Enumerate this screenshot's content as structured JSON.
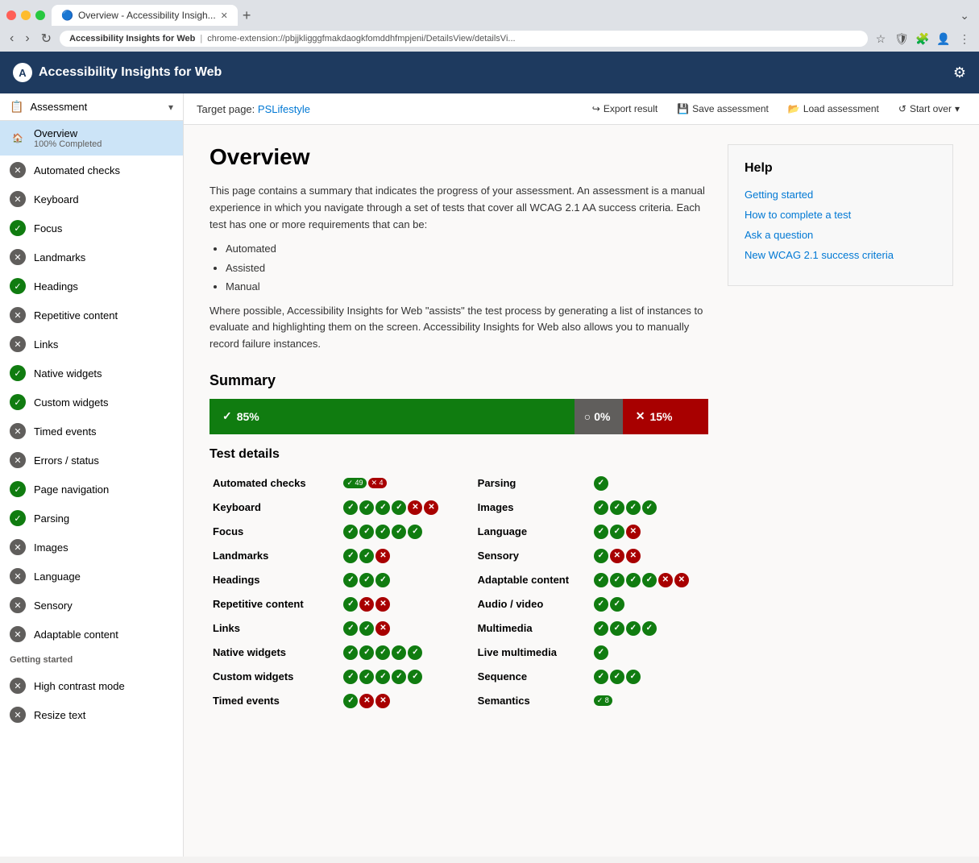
{
  "browser": {
    "tab_title": "Overview - Accessibility Insigh...",
    "tab_favicon": "🔵",
    "address_site": "Accessibility Insights for Web",
    "address_sep": "|",
    "address_url": "chrome-extension://pbjjkligggfmakdaogkfomddhfmpjeni/DetailsView/detailsVi..."
  },
  "app": {
    "title": "Accessibility Insights for Web",
    "logo_text": "A"
  },
  "toolbar": {
    "target_page_label": "Target page:",
    "target_page_link": "PSLifestyle",
    "export_label": "Export result",
    "save_label": "Save assessment",
    "load_label": "Load assessment",
    "start_over_label": "Start over"
  },
  "sidebar": {
    "assessment_label": "Assessment",
    "overview_label": "Overview",
    "overview_sublabel": "100% Completed",
    "items": [
      {
        "label": "Automated checks",
        "status": "fail"
      },
      {
        "label": "Keyboard",
        "status": "fail"
      },
      {
        "label": "Focus",
        "status": "pass"
      },
      {
        "label": "Landmarks",
        "status": "fail"
      },
      {
        "label": "Headings",
        "status": "pass"
      },
      {
        "label": "Repetitive content",
        "status": "fail"
      },
      {
        "label": "Links",
        "status": "fail"
      },
      {
        "label": "Native widgets",
        "status": "pass"
      },
      {
        "label": "Custom widgets",
        "status": "pass"
      },
      {
        "label": "Timed events",
        "status": "fail"
      },
      {
        "label": "Errors / status",
        "status": "fail"
      },
      {
        "label": "Page navigation",
        "status": "pass"
      },
      {
        "label": "Parsing",
        "status": "pass"
      },
      {
        "label": "Images",
        "status": "fail"
      },
      {
        "label": "Language",
        "status": "fail"
      },
      {
        "label": "Sensory",
        "status": "fail"
      },
      {
        "label": "Adaptable content",
        "status": "fail"
      }
    ],
    "getting_started_label": "Getting started",
    "getting_started_items": [
      {
        "label": "High contrast mode",
        "status": "fail"
      },
      {
        "label": "Resize text",
        "status": "fail"
      }
    ]
  },
  "overview": {
    "title": "Overview",
    "description1": "This page contains a summary that indicates the progress of your assessment. An assessment is a manual experience in which you navigate through a set of tests that cover all WCAG 2.1 AA success criteria. Each test has one or more requirements that can be:",
    "bullets": [
      "Automated",
      "Assisted",
      "Manual"
    ],
    "description2": "Where possible, Accessibility Insights for Web \"assists\" the test process by generating a list of instances to evaluate and highlighting them on the screen. Accessibility Insights for Web also allows you to manually record failure instances.",
    "summary_title": "Summary",
    "bar_pass": "85%",
    "bar_unknown": "0%",
    "bar_fail": "15%",
    "test_details_title": "Test details",
    "tests_left": [
      {
        "name": "Automated checks",
        "icons": [
          {
            "type": "num",
            "val": "49"
          },
          {
            "type": "num-fail",
            "val": "4"
          }
        ]
      },
      {
        "name": "Keyboard",
        "icons": [
          {
            "type": "pass"
          },
          {
            "type": "pass"
          },
          {
            "type": "pass"
          },
          {
            "type": "pass"
          },
          {
            "type": "fail"
          },
          {
            "type": "fail"
          }
        ]
      },
      {
        "name": "Focus",
        "icons": [
          {
            "type": "pass"
          },
          {
            "type": "pass"
          },
          {
            "type": "pass"
          },
          {
            "type": "pass"
          },
          {
            "type": "pass"
          }
        ]
      },
      {
        "name": "Landmarks",
        "icons": [
          {
            "type": "pass"
          },
          {
            "type": "pass"
          },
          {
            "type": "fail"
          }
        ]
      },
      {
        "name": "Headings",
        "icons": [
          {
            "type": "pass"
          },
          {
            "type": "pass"
          },
          {
            "type": "pass"
          }
        ]
      },
      {
        "name": "Repetitive content",
        "icons": [
          {
            "type": "pass"
          },
          {
            "type": "fail"
          },
          {
            "type": "fail"
          }
        ]
      },
      {
        "name": "Links",
        "icons": [
          {
            "type": "pass"
          },
          {
            "type": "pass"
          },
          {
            "type": "fail"
          }
        ]
      },
      {
        "name": "Native widgets",
        "icons": [
          {
            "type": "pass"
          },
          {
            "type": "pass"
          },
          {
            "type": "pass"
          },
          {
            "type": "pass"
          },
          {
            "type": "pass"
          }
        ]
      },
      {
        "name": "Custom widgets",
        "icons": [
          {
            "type": "pass"
          },
          {
            "type": "pass"
          },
          {
            "type": "pass"
          },
          {
            "type": "pass"
          },
          {
            "type": "pass"
          }
        ]
      },
      {
        "name": "Timed events",
        "icons": [
          {
            "type": "pass"
          },
          {
            "type": "fail"
          },
          {
            "type": "fail"
          }
        ]
      }
    ],
    "tests_right": [
      {
        "name": "Parsing",
        "icons": [
          {
            "type": "pass"
          }
        ]
      },
      {
        "name": "Images",
        "icons": [
          {
            "type": "pass"
          },
          {
            "type": "pass"
          },
          {
            "type": "pass"
          },
          {
            "type": "pass"
          }
        ]
      },
      {
        "name": "Language",
        "icons": [
          {
            "type": "pass"
          },
          {
            "type": "pass"
          },
          {
            "type": "fail"
          }
        ]
      },
      {
        "name": "Sensory",
        "icons": [
          {
            "type": "pass"
          },
          {
            "type": "fail"
          },
          {
            "type": "fail"
          }
        ]
      },
      {
        "name": "Adaptable content",
        "icons": [
          {
            "type": "pass"
          },
          {
            "type": "pass"
          },
          {
            "type": "pass"
          },
          {
            "type": "pass"
          },
          {
            "type": "fail"
          },
          {
            "type": "fail"
          }
        ]
      },
      {
        "name": "Audio / video",
        "icons": [
          {
            "type": "pass"
          },
          {
            "type": "pass"
          }
        ]
      },
      {
        "name": "Multimedia",
        "icons": [
          {
            "type": "pass"
          },
          {
            "type": "pass"
          },
          {
            "type": "pass"
          },
          {
            "type": "pass"
          }
        ]
      },
      {
        "name": "Live multimedia",
        "icons": [
          {
            "type": "pass"
          }
        ]
      },
      {
        "name": "Sequence",
        "icons": [
          {
            "type": "pass"
          },
          {
            "type": "pass"
          },
          {
            "type": "pass"
          }
        ]
      },
      {
        "name": "Semantics",
        "icons": [
          {
            "type": "num",
            "val": "8"
          }
        ]
      }
    ]
  },
  "help": {
    "title": "Help",
    "links": [
      "Getting started",
      "How to complete a test",
      "Ask a question",
      "New WCAG 2.1 success criteria"
    ]
  }
}
